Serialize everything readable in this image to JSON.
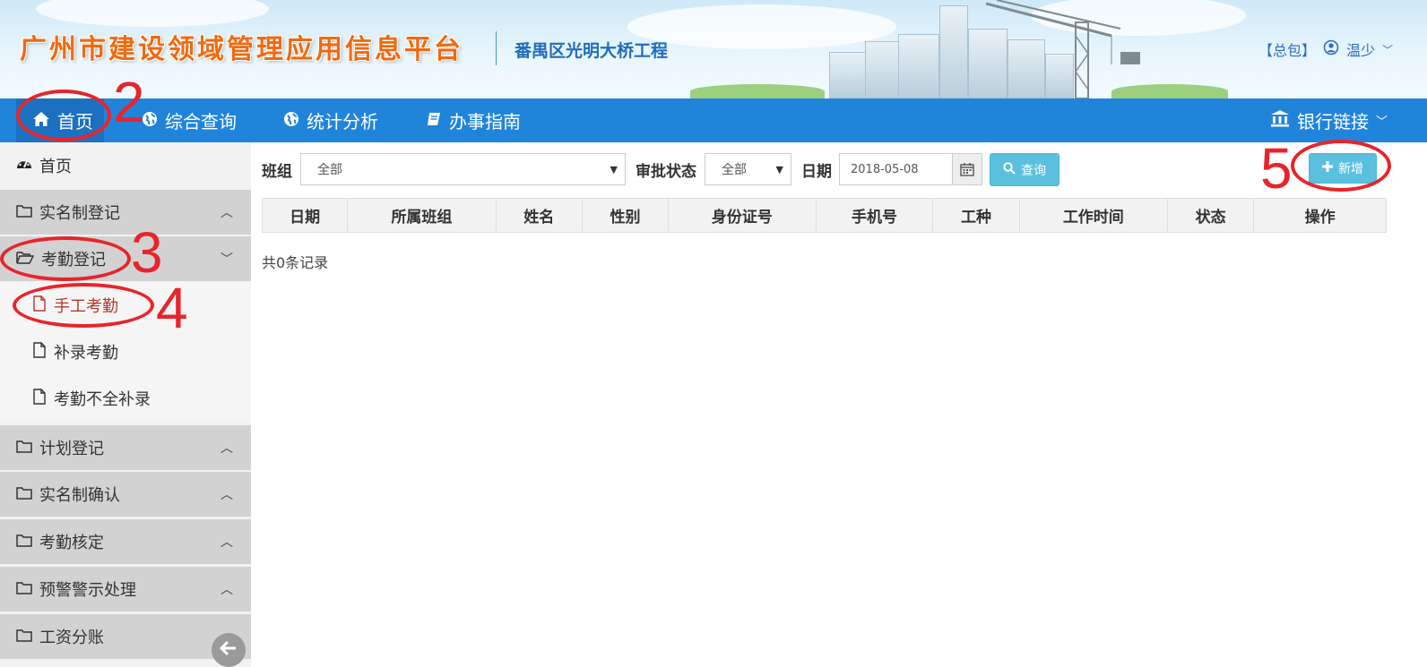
{
  "header": {
    "site_title": "广州市建设领域管理应用信息平台",
    "project_name": "番禺区光明大桥工程",
    "role_label": "【总包】",
    "user_name": "温少",
    "user_icon": "user-circle-icon"
  },
  "nav": {
    "items": [
      {
        "label": "首页",
        "icon": "home-icon"
      },
      {
        "label": "综合查询",
        "icon": "globe-icon"
      },
      {
        "label": "统计分析",
        "icon": "globe-icon"
      },
      {
        "label": "办事指南",
        "icon": "book-icon"
      }
    ],
    "right_label": "银行链接",
    "right_icon": "bank-icon"
  },
  "sidebar": {
    "home": "首页",
    "items": [
      {
        "label": "实名制登记"
      },
      {
        "label": "考勤登记",
        "expanded": true,
        "children": [
          {
            "label": "手工考勤",
            "active": true
          },
          {
            "label": "补录考勤"
          },
          {
            "label": "考勤不全补录"
          }
        ]
      },
      {
        "label": "计划登记"
      },
      {
        "label": "实名制确认"
      },
      {
        "label": "考勤核定"
      },
      {
        "label": "预警警示处理"
      },
      {
        "label": "工资分账"
      }
    ]
  },
  "filters": {
    "team_label": "班组",
    "team_value": "全部",
    "status_label": "审批状态",
    "status_value": "全部",
    "date_label": "日期",
    "date_value": "2018-05-08",
    "query_button": "查询",
    "add_button": "新增"
  },
  "table": {
    "columns": [
      "日期",
      "所属班组",
      "姓名",
      "性别",
      "身份证号",
      "手机号",
      "工种",
      "工作时间",
      "状态",
      "操作"
    ],
    "rows": [],
    "record_count": "共0条记录"
  },
  "annotations": {
    "step_2": "2",
    "step_3": "3",
    "step_4": "4",
    "step_5": "5",
    "color": "#e8242b"
  },
  "colors": {
    "nav_bg": "#2184db",
    "button_bg": "#5bc0de",
    "title_orange": "#f06a10"
  }
}
